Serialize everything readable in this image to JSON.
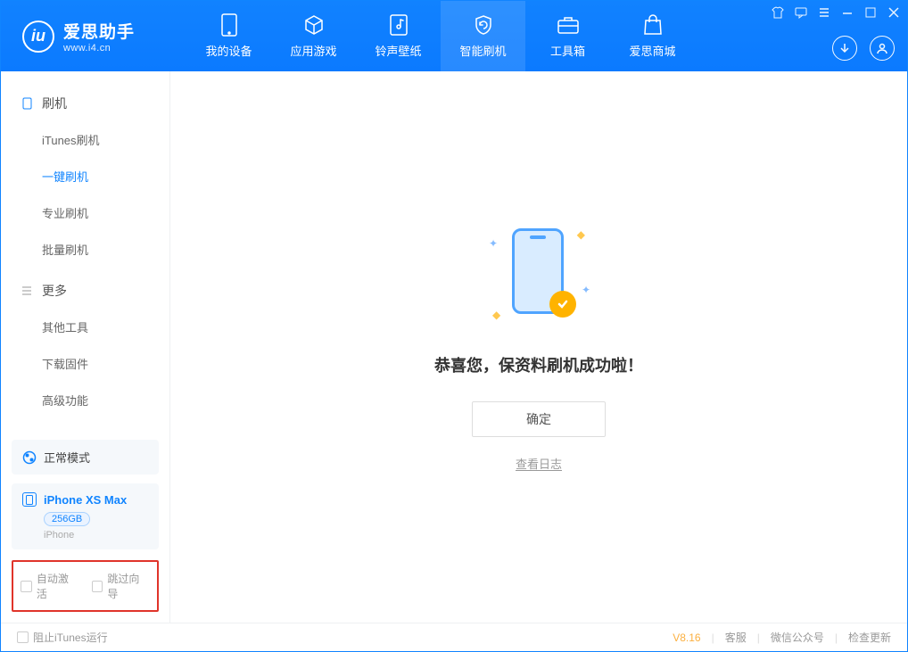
{
  "app": {
    "title": "爱思助手",
    "subtitle": "www.i4.cn"
  },
  "nav": {
    "device": "我的设备",
    "apps": "应用游戏",
    "ringtone": "铃声壁纸",
    "flash": "智能刷机",
    "tools": "工具箱",
    "store": "爱思商城"
  },
  "sidebar": {
    "section1": {
      "title": "刷机",
      "items": [
        "iTunes刷机",
        "一键刷机",
        "专业刷机",
        "批量刷机"
      ]
    },
    "section2": {
      "title": "更多",
      "items": [
        "其他工具",
        "下载固件",
        "高级功能"
      ]
    },
    "mode": "正常模式",
    "device": {
      "name": "iPhone XS Max",
      "capacity": "256GB",
      "type": "iPhone"
    },
    "checks": {
      "auto_activate": "自动激活",
      "skip_guide": "跳过向导"
    }
  },
  "main": {
    "message": "恭喜您，保资料刷机成功啦！",
    "ok": "确定",
    "view_log": "查看日志"
  },
  "footer": {
    "block_itunes": "阻止iTunes运行",
    "version": "V8.16",
    "support": "客服",
    "wechat": "微信公众号",
    "update": "检查更新"
  }
}
